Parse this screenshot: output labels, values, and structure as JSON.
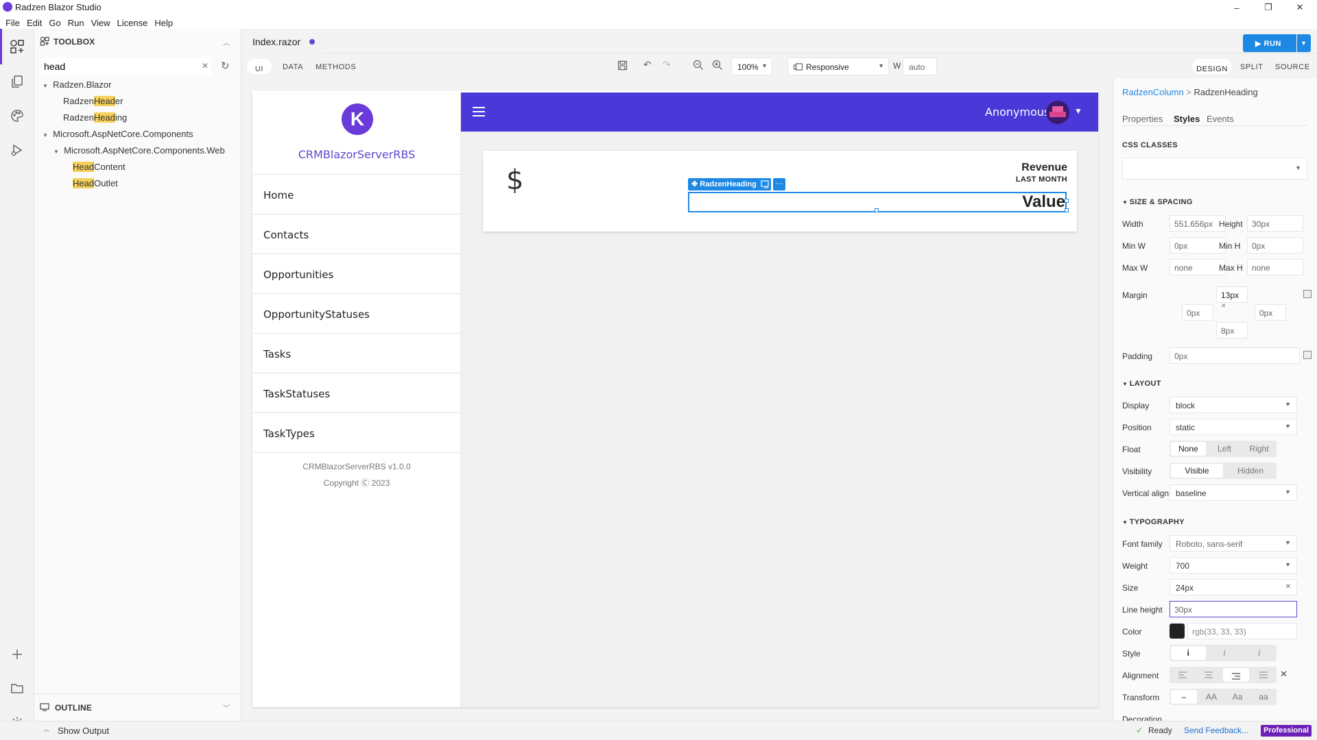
{
  "window": {
    "title": "Radzen Blazor Studio",
    "controls": [
      "–",
      "❐",
      "✕"
    ]
  },
  "menu": [
    "File",
    "Edit",
    "Go",
    "Run",
    "View",
    "License",
    "Help"
  ],
  "toolbox": {
    "title": "TOOLBOX",
    "search_value": "head",
    "tree": [
      {
        "text": "Radzen.Blazor",
        "level": 0,
        "expanded": true
      },
      {
        "pre": "Radzen",
        "match": "Head",
        "post": "er",
        "level": 1
      },
      {
        "pre": "Radzen",
        "match": "Head",
        "post": "ing",
        "level": 1
      },
      {
        "text": "Microsoft.AspNetCore.Components",
        "level": 0,
        "expanded": true
      },
      {
        "text": "Microsoft.AspNetCore.Components.Web",
        "level": 1,
        "expanded": true
      },
      {
        "pre": "",
        "match": "Head",
        "post": "Content",
        "level": 2
      },
      {
        "pre": "",
        "match": "Head",
        "post": "Outlet",
        "level": 2
      }
    ],
    "outline_label": "OUTLINE",
    "show_output_label": "Show Output"
  },
  "editor": {
    "tab_label": "Index.razor",
    "modes": [
      "UI",
      "DATA",
      "METHODS"
    ],
    "zoom": "100%",
    "viewport": "Responsive",
    "width_label": "W",
    "width_value": "auto",
    "run_label": "RUN",
    "views": [
      "DESIGN",
      "SPLIT",
      "SOURCE"
    ]
  },
  "app": {
    "logo_letter": "K",
    "name": "CRMBlazorServerRBS",
    "user": "Anonymous",
    "nav": [
      "Home",
      "Contacts",
      "Opportunities",
      "OpportunityStatuses",
      "Tasks",
      "TaskStatuses",
      "TaskTypes"
    ],
    "footer_version": "CRMBlazorServerRBS v1.0.0",
    "footer_copyright": "Copyright Ⓒ 2023",
    "card": {
      "icon": "$",
      "title": "Revenue",
      "subtitle": "LAST MONTH",
      "value": "Value",
      "selection_label": "RadzenHeading"
    }
  },
  "properties": {
    "breadcrumb_parent": "RadzenColumn",
    "breadcrumb_sep": ">",
    "breadcrumb_current": "RadzenHeading",
    "tabs": [
      "Properties",
      "Styles",
      "Events"
    ],
    "css_classes_label": "CSS CLASSES",
    "size_section": "SIZE & SPACING",
    "width_label": "Width",
    "width_value": "551.656px",
    "height_label": "Height",
    "height_value": "30px",
    "minw_label": "Min W",
    "minw_value": "0px",
    "minh_label": "Min H",
    "minh_value": "0px",
    "maxw_label": "Max W",
    "maxw_value": "none",
    "maxh_label": "Max H",
    "maxh_value": "none",
    "margin_label": "Margin",
    "margin_top": "13px",
    "margin_left": "0px",
    "margin_right": "0px",
    "margin_bottom": "8px",
    "padding_label": "Padding",
    "padding_value": "0px",
    "layout_section": "LAYOUT",
    "display_label": "Display",
    "display_value": "block",
    "position_label": "Position",
    "position_value": "static",
    "float_label": "Float",
    "float_options": [
      "None",
      "Left",
      "Right"
    ],
    "visibility_label": "Visibility",
    "visibility_options": [
      "Visible",
      "Hidden"
    ],
    "valign_label": "Vertical align",
    "valign_value": "baseline",
    "typography_section": "TYPOGRAPHY",
    "font_family_label": "Font family",
    "font_family_value": "Roboto, sans-serif",
    "weight_label": "Weight",
    "weight_value": "700",
    "size_label": "Size",
    "size_value": "24px",
    "line_height_label": "Line height",
    "line_height_value": "30px",
    "color_label": "Color",
    "color_value": "rgb(33, 33, 33)",
    "color_swatch": "#212121",
    "style_label": "Style",
    "style_options": [
      "i",
      "i",
      "i"
    ],
    "alignment_label": "Alignment",
    "transform_label": "Transform",
    "transform_options": [
      "–",
      "AA",
      "Aa",
      "aa"
    ],
    "decoration_label": "Decoration"
  },
  "status": {
    "ready": "Ready",
    "feedback": "Send Feedback...",
    "edition": "Professional"
  },
  "colors": {
    "accent": "#4b38d8",
    "run": "#1e88e5",
    "selection": "#1e88e5",
    "edition": "#6a1fb5"
  }
}
